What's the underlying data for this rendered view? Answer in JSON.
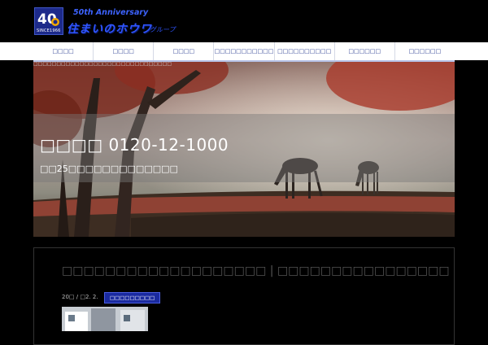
{
  "header": {
    "logo_number": "40",
    "logo_since": "SINCE1966",
    "anniversary": "50th Anniversary",
    "brand": "住まいのホウワ",
    "brand_sub": "グループ"
  },
  "nav": {
    "items": [
      "□□□□",
      "□□□□",
      "□□□□",
      "□□□□□□□□□□□",
      "□□□□□□□□□□",
      "□□□□□□",
      "□□□□□□"
    ]
  },
  "ticker": "□□□□□□□□□□□□□□□□□□□□□□□□□□□□□□□□□□□□□□□□",
  "hero": {
    "phone": "□□□□ 0120-12-1000",
    "sub": "□□25□□□□□□□□□□□□□"
  },
  "post": {
    "title": "□□□□□□□□□□□□□□□□□□□ | □□□□□□□□□□□□□□□□",
    "date": "20□ / □2. 2.",
    "category": "□□□□□□□□□"
  }
}
